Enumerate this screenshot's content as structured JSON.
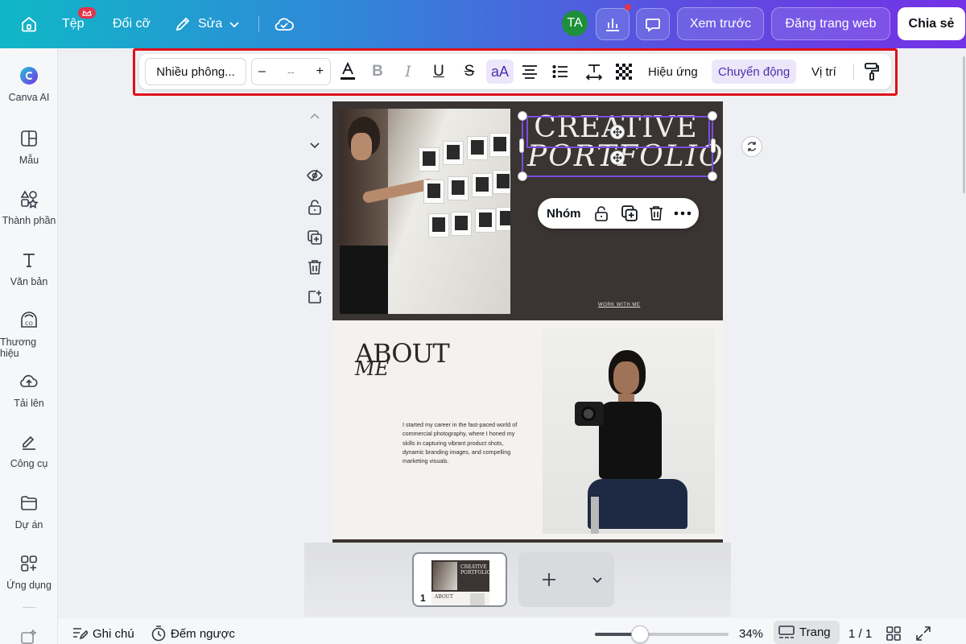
{
  "header": {
    "file_label": "Tệp",
    "resize_label": "Đổi cỡ",
    "edit_label": "Sửa",
    "avatar_initials": "TA",
    "preview_label": "Xem trước",
    "publish_label": "Đăng trang web",
    "share_label": "Chia sẻ",
    "colors": {
      "gradient_start": "#10b7c7",
      "gradient_end": "#7432e6",
      "badge": "#e2344a",
      "avatar_bg": "#1e8f3a"
    }
  },
  "sidebar": {
    "items": [
      {
        "label": "Canva AI",
        "icon": "canva-ai-icon"
      },
      {
        "label": "Mẫu",
        "icon": "templates-icon"
      },
      {
        "label": "Thành phần",
        "icon": "elements-icon"
      },
      {
        "label": "Văn bản",
        "icon": "text-icon"
      },
      {
        "label": "Thương hiệu",
        "icon": "brand-icon"
      },
      {
        "label": "Tải lên",
        "icon": "upload-icon"
      },
      {
        "label": "Công cụ",
        "icon": "tools-icon"
      },
      {
        "label": "Dự án",
        "icon": "projects-icon"
      },
      {
        "label": "Ứng dụng",
        "icon": "apps-icon"
      }
    ]
  },
  "toolbar": {
    "font_name": "Nhiều phông...",
    "font_size_value": "--",
    "decrease_label": "–",
    "increase_label": "+",
    "case_label": "aA",
    "effects_label": "Hiệu ứng",
    "animate_label": "Chuyển động",
    "position_label": "Vị trí",
    "accent_color": "#e0101a"
  },
  "design": {
    "title_line1": "CREATIVE",
    "title_line2": "PORTFOLIO",
    "work_link": "WORK WITH ME",
    "about_heading": "ABOUT",
    "about_subheading": "ME",
    "bio": "I started my career in the fast-paced world of commercial photography, where I honed my skills in capturing vibrant product shots, dynamic branding images, and compelling marketing visuals."
  },
  "context_menu": {
    "group_label": "Nhóm"
  },
  "thumbnail": {
    "page_number": "1",
    "title_line1": "CREATIVE",
    "title_line2": "PORTFOLIO",
    "about": "ABOUT"
  },
  "bottombar": {
    "notes_label": "Ghi chú",
    "timer_label": "Đếm ngược",
    "zoom_label": "34%",
    "zoom_fraction": 0.34,
    "pages_label": "Trang",
    "page_counter": "1 / 1"
  }
}
